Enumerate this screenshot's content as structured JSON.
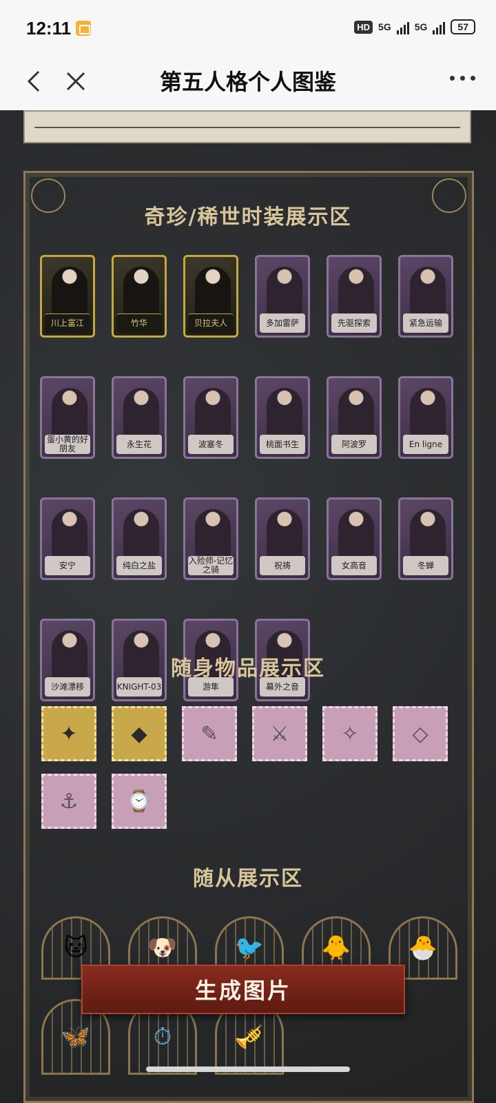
{
  "status": {
    "time": "12:11",
    "hd": "HD",
    "net1": "5G",
    "net2": "5G",
    "battery": "57"
  },
  "nav": {
    "title": "第五人格个人图鉴"
  },
  "sections": {
    "costumes_title": "奇珍/稀世时装展示区",
    "items_title": "随身物品展示区",
    "pets_title": "随从展示区"
  },
  "costumes": [
    {
      "name": "川上富江",
      "gold": true
    },
    {
      "name": "竹华",
      "gold": true
    },
    {
      "name": "贝拉夫人",
      "gold": true
    },
    {
      "name": "多加雷萨",
      "gold": false
    },
    {
      "name": "先驱探索",
      "gold": false
    },
    {
      "name": "紧急运输",
      "gold": false
    },
    {
      "name": "蛋小黄的好朋友",
      "gold": false
    },
    {
      "name": "永生花",
      "gold": false
    },
    {
      "name": "波塞冬",
      "gold": false
    },
    {
      "name": "桃面书生",
      "gold": false
    },
    {
      "name": "阿波罗",
      "gold": false
    },
    {
      "name": "En ligne",
      "gold": false
    },
    {
      "name": "安宁",
      "gold": false
    },
    {
      "name": "纯白之盐",
      "gold": false
    },
    {
      "name": "入殓师-记忆之骑",
      "gold": false
    },
    {
      "name": "祝祷",
      "gold": false
    },
    {
      "name": "女高音",
      "gold": false
    },
    {
      "name": "冬蝉",
      "gold": false
    },
    {
      "name": "沙滩漂移",
      "gold": false
    },
    {
      "name": "KNIGHT-03",
      "gold": false
    },
    {
      "name": "游隼",
      "gold": false
    },
    {
      "name": "幕外之音",
      "gold": false
    }
  ],
  "items": [
    {
      "icon": "✦",
      "gold": true
    },
    {
      "icon": "◆",
      "gold": true
    },
    {
      "icon": "✎",
      "gold": false
    },
    {
      "icon": "⚔",
      "gold": false
    },
    {
      "icon": "✧",
      "gold": false
    },
    {
      "icon": "◇",
      "gold": false
    },
    {
      "icon": "⚓",
      "gold": false
    },
    {
      "icon": "⌚",
      "gold": false
    }
  ],
  "pets": [
    "🐱",
    "🐶",
    "🐦",
    "🐥",
    "🐣"
  ],
  "pets_row2": [
    "🦋",
    "⏱",
    "🎺"
  ],
  "generate_button": "生成图片"
}
